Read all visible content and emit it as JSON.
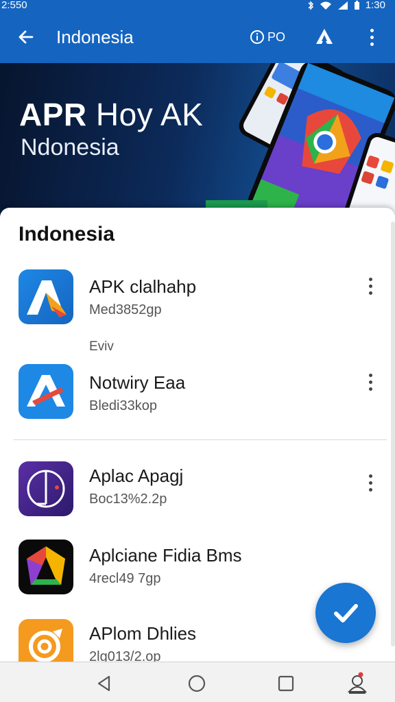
{
  "status": {
    "time": "2:550",
    "battery": "1:30"
  },
  "appbar": {
    "title": "Indonesia",
    "info_label": "PO"
  },
  "hero": {
    "title_bold": "APR",
    "title_light": "Hoy AK",
    "subtitle": "Ndonesia"
  },
  "sheet": {
    "title": "Indonesia",
    "section_label": "Eviv"
  },
  "apps": [
    {
      "name": "APK clalhahp",
      "size": "Med3852gp"
    },
    {
      "name": "Notwiry Eaa",
      "size": "Bledi33kop"
    },
    {
      "name": "Aplac Apagj",
      "size": "Boc13%2.2p"
    },
    {
      "name": "Aplciane Fidia Bms",
      "size": "4recl49 7gp"
    },
    {
      "name": "APlom Dhlies",
      "size": "2lg013/2.op"
    }
  ],
  "colors": {
    "primary": "#1565c0",
    "fab": "#1976d2"
  }
}
